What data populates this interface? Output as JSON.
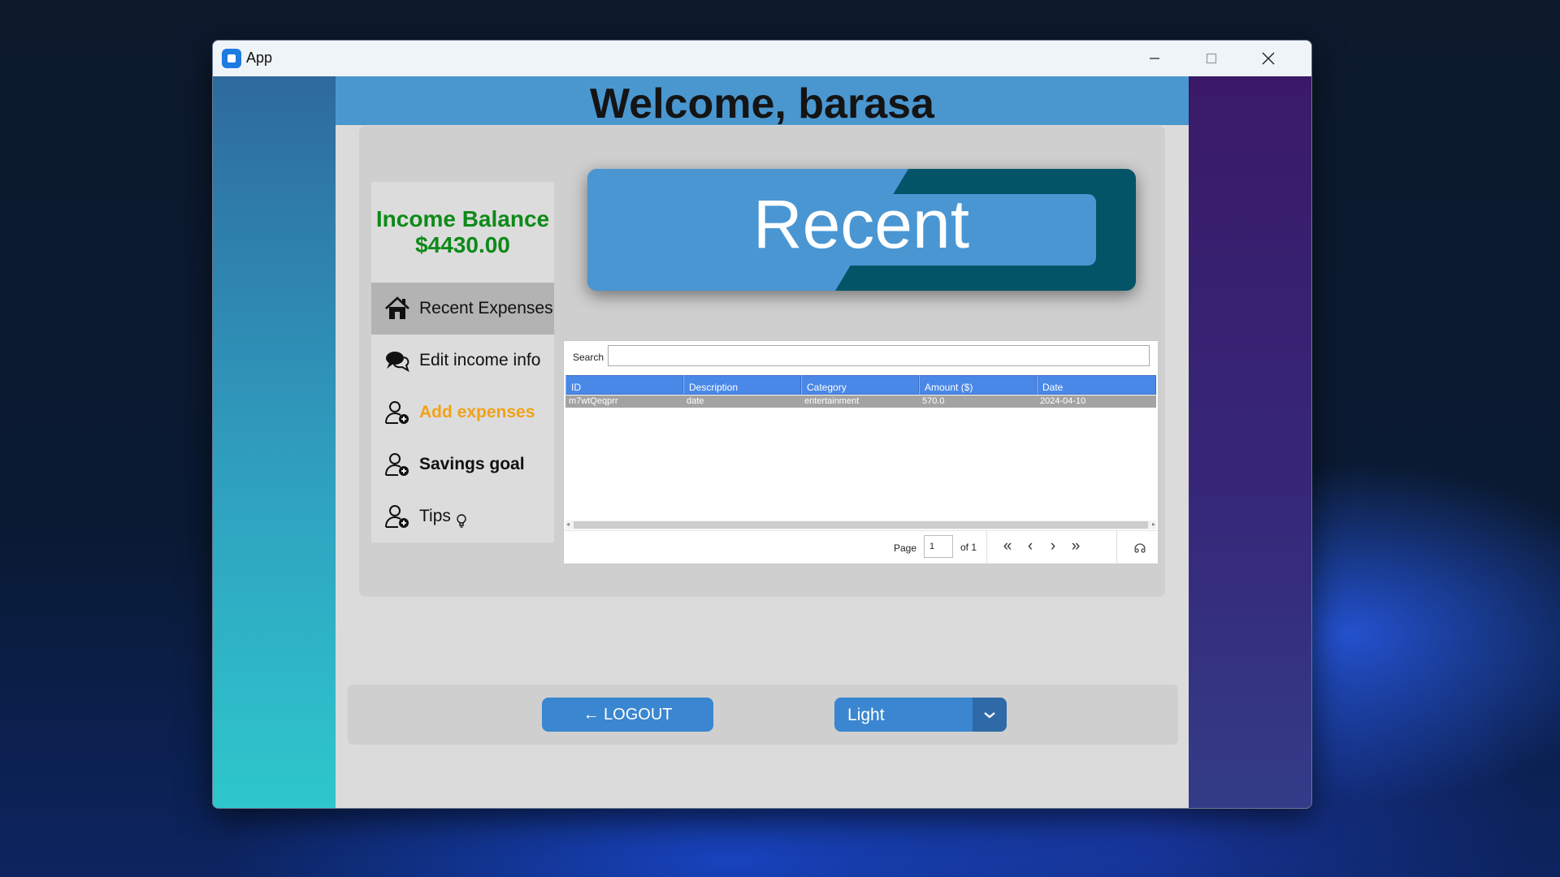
{
  "window": {
    "title": "App"
  },
  "header": {
    "welcome": "Welcome, barasa"
  },
  "sidebar": {
    "balance_label": "Income Balance",
    "balance_value": "$4430.00",
    "items": [
      {
        "label": "Recent Expenses",
        "icon": "home-icon",
        "color": "#111111",
        "active": true
      },
      {
        "label": "Edit income info",
        "icon": "chat-bubbles-icon",
        "color": "#111111"
      },
      {
        "label": "Add expenses",
        "icon": "user-add-icon",
        "color": "#f0a21a"
      },
      {
        "label": "Savings goal",
        "icon": "user-add-icon",
        "color": "#111111"
      },
      {
        "label": "Tips",
        "icon": "user-add-icon",
        "color": "#111111",
        "badge_icon": "lightbulb-icon"
      }
    ]
  },
  "banner": {
    "title": "Recent"
  },
  "table": {
    "search_label": "Search",
    "search_value": "",
    "columns": [
      "ID",
      "Description",
      "Category",
      "Amount ($)",
      "Date"
    ],
    "rows": [
      [
        "m7wtQeqprr",
        "date",
        "entertainment",
        "570.0",
        "2024-04-10"
      ]
    ],
    "pager": {
      "page_label": "Page",
      "page_value": "1",
      "of_label": "of 1"
    }
  },
  "bottom": {
    "logout_label": "← LOGOUT",
    "theme_value": "Light"
  },
  "colors": {
    "header_blue": "#4a97d0",
    "balance_green": "#0d8a18",
    "table_header": "#4a88e8",
    "button_blue": "#3a86d0",
    "accent_orange": "#f0a21a"
  }
}
